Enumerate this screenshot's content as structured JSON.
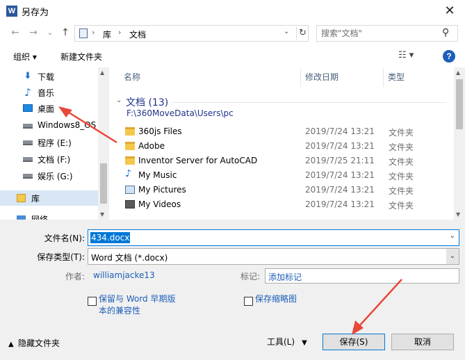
{
  "window": {
    "app_icon_letter": "W",
    "title": "另存为",
    "close_glyph": "✕"
  },
  "nav": {
    "back": "←",
    "forward": "→",
    "dropdown": "⌄",
    "up": "↑",
    "breadcrumb": [
      "库",
      "文档"
    ],
    "separator": "›",
    "refresh": "↻",
    "search_placeholder": "搜索\"文档\""
  },
  "toolbar": {
    "organize": "组织 ▾",
    "new_folder": "新建文件夹",
    "view": "☷ ▾",
    "help": "?"
  },
  "sidebar": {
    "items": [
      {
        "label": "下载",
        "icon": "download-icon"
      },
      {
        "label": "音乐",
        "icon": "music-icon"
      },
      {
        "label": "桌面",
        "icon": "desktop-icon"
      },
      {
        "label": "Windows8_OS",
        "icon": "drive-icon"
      },
      {
        "label": "程序 (E:)",
        "icon": "drive-icon"
      },
      {
        "label": "文档 (F:)",
        "icon": "drive-icon"
      },
      {
        "label": "娱乐 (G:)",
        "icon": "drive-icon"
      },
      {
        "label": "库",
        "icon": "library-icon"
      },
      {
        "label": "网络",
        "icon": "network-icon"
      }
    ]
  },
  "file_list": {
    "columns": [
      "名称",
      "修改日期",
      "类型"
    ],
    "group": {
      "title": "文档 (13)",
      "path": "F:\\360MoveData\\Users\\pc"
    },
    "rows": [
      {
        "name": "360js Files",
        "date": "2019/7/24 13:21",
        "type": "文件夹",
        "icon": "folder-icon"
      },
      {
        "name": "Adobe",
        "date": "2019/7/24 13:21",
        "type": "文件夹",
        "icon": "folder-icon"
      },
      {
        "name": "Inventor Server for AutoCAD",
        "date": "2019/7/25 21:11",
        "type": "文件夹",
        "icon": "folder-icon"
      },
      {
        "name": "My Music",
        "date": "2019/7/24 13:21",
        "type": "文件夹",
        "icon": "music-folder-icon"
      },
      {
        "name": "My Pictures",
        "date": "2019/7/24 13:21",
        "type": "文件夹",
        "icon": "pictures-folder-icon"
      },
      {
        "name": "My Videos",
        "date": "2019/7/24 13:21",
        "type": "文件夹",
        "icon": "videos-folder-icon"
      }
    ]
  },
  "form": {
    "filename_label": "文件名(N):",
    "filename_value": "434.docx",
    "filetype_label": "保存类型(T):",
    "filetype_value": "Word 文档 (*.docx)",
    "author_label": "作者:",
    "author_value": "williamjacke13",
    "tags_label": "标记:",
    "tags_value": "添加标记",
    "compat_line1": "保留与 Word 早期版",
    "compat_line2": "本的兼容性",
    "thumbnail_label": "保存缩略图"
  },
  "footer": {
    "hide_folders": "隐藏文件夹",
    "tools": "工具(L)",
    "save": "保存(S)",
    "cancel": "取消"
  },
  "colors": {
    "accent": "#0078d7",
    "link": "#1c5fb9",
    "annotation": "#e8483a"
  }
}
